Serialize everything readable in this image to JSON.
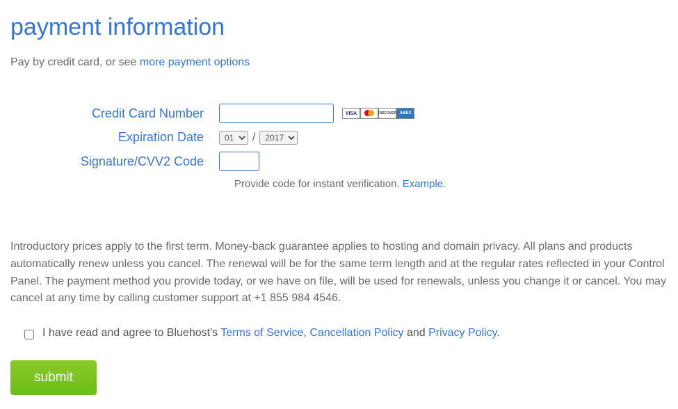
{
  "header": {
    "title": "payment information"
  },
  "pay_line": {
    "prefix": "Pay by credit card, or see ",
    "link": "more payment options"
  },
  "form": {
    "cc_label": "Credit Card Number",
    "exp_label": "Expiration Date",
    "cvv_label": "Signature/CVV2 Code",
    "exp_month": "01",
    "exp_year": "2017",
    "cvv_help_text": "Provide code for instant verification. ",
    "cvv_example_link": "Example"
  },
  "cards": {
    "visa": "VISA",
    "discover": "DISCOVER",
    "amex": "AMEX"
  },
  "disclaimer": "Introductory prices apply to the first term. Money-back guarantee applies to hosting and domain privacy. All plans and products automatically renew unless you cancel. The renewal will be for the same term length and at the regular rates reflected in your Control Panel. The payment method you provide today, or we have on file, will be used for renewals, unless you change it or cancel. You may cancel at any time by calling customer support at +1 855 984 4546.",
  "agree": {
    "prefix": "I have read and agree to Bluehost's ",
    "tos": "Terms of Service",
    "comma": ", ",
    "cancel": "Cancellation Policy",
    "and": " and ",
    "privacy": "Privacy Policy",
    "period": "."
  },
  "submit_label": "submit"
}
